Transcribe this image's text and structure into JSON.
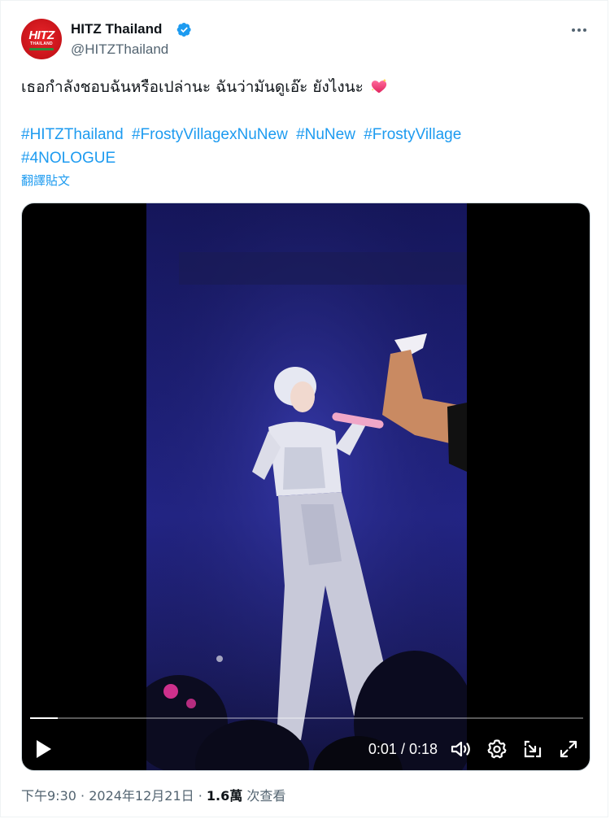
{
  "author": {
    "display_name": "HITZ Thailand",
    "handle": "@HITZThailand",
    "avatar_logo": "HITZ",
    "avatar_sub": "THAILAND",
    "verified": true
  },
  "tweet": {
    "text": "เธอกำลังชอบฉันหรือเปล่านะ ฉันว่ามันดูเอ๊ะ ยังไงนะ",
    "hashtags": [
      "#HITZThailand",
      "#FrostyVillagexNuNew",
      "#NuNew",
      "#FrostyVillage",
      "#4NOLOGUE"
    ],
    "translate_label": "翻譯貼文"
  },
  "video": {
    "current_time": "0:01",
    "duration": "0:18",
    "time_separator": " / ",
    "progress_fraction": 0.05
  },
  "footer": {
    "time": "下午9:30",
    "date": "2024年12月21日",
    "separator": " · ",
    "views_count": "1.6萬",
    "views_label": "次查看"
  },
  "colors": {
    "link": "#1d9bf0",
    "muted": "#536471",
    "text": "#0f1419",
    "verified": "#1d9bf0",
    "brand_red": "#d81b22"
  },
  "icons": {
    "verified": "verified-badge-icon",
    "more": "more-options-icon",
    "heart": "sparkling-heart-icon",
    "play": "play-icon",
    "volume": "volume-icon",
    "settings": "settings-gear-icon",
    "pip": "picture-in-picture-icon",
    "fullscreen": "fullscreen-icon"
  }
}
